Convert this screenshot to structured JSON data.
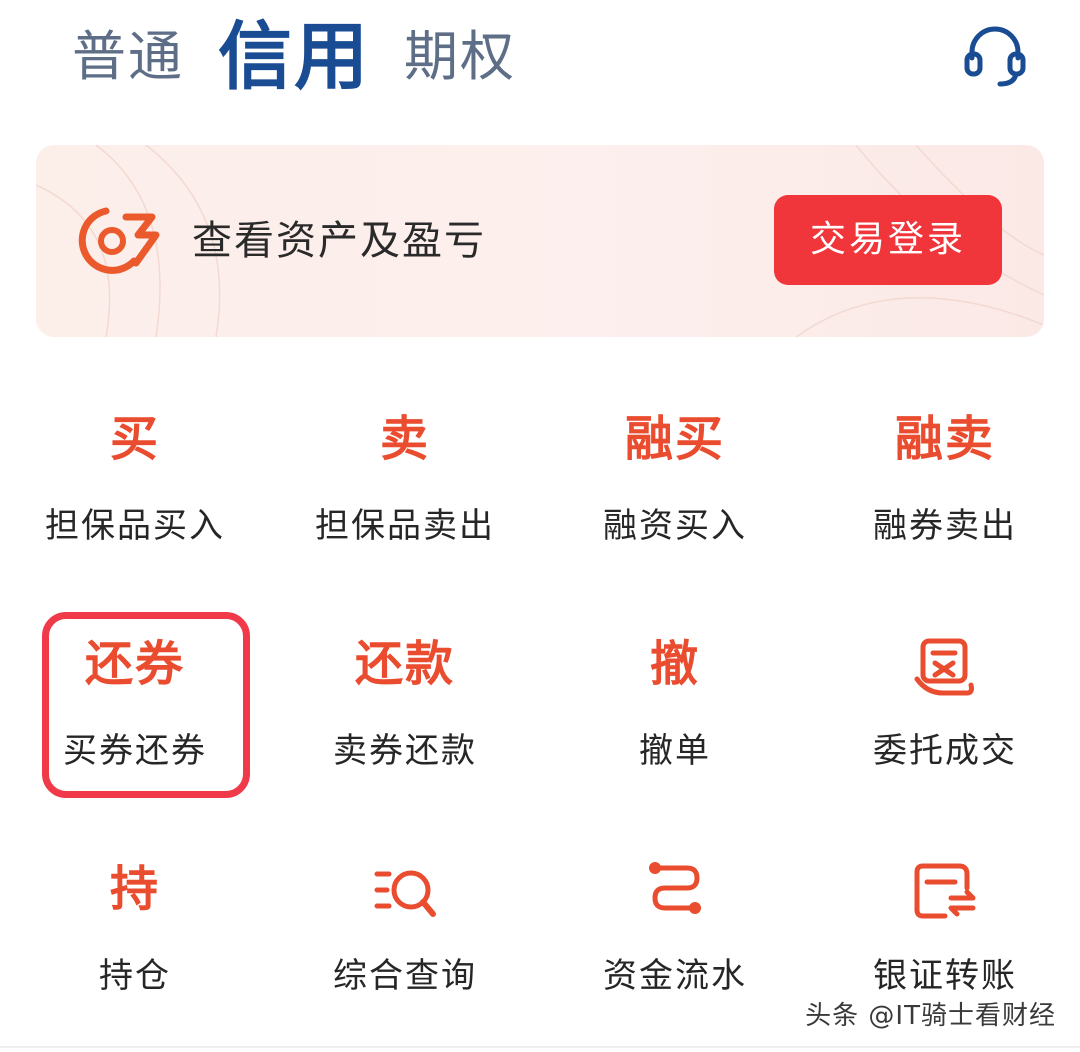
{
  "tabs": [
    {
      "label": "普通",
      "active": false
    },
    {
      "label": "信用",
      "active": true
    },
    {
      "label": "期权",
      "active": false
    }
  ],
  "header": {
    "service_icon": "headset-icon"
  },
  "banner": {
    "text": "查看资产及盈亏",
    "button_label": "交易登录",
    "logo_icon": "brand-logo-icon"
  },
  "grid": [
    {
      "glyph": "买",
      "label": "担保品买入"
    },
    {
      "glyph": "卖",
      "label": "担保品卖出"
    },
    {
      "glyph": "融买",
      "label": "融资买入"
    },
    {
      "glyph": "融卖",
      "label": "融券卖出"
    },
    {
      "glyph": "还券",
      "label": "买券还券",
      "highlighted": true
    },
    {
      "glyph": "还款",
      "label": "卖券还款"
    },
    {
      "glyph": "撤",
      "label": "撤单"
    },
    {
      "glyph": "",
      "icon": "entrust-deal-icon",
      "label": "委托成交"
    },
    {
      "glyph": "持",
      "label": "持仓"
    },
    {
      "glyph": "",
      "icon": "search-list-icon",
      "label": "综合查询"
    },
    {
      "glyph": "",
      "icon": "fund-flow-icon",
      "label": "资金流水"
    },
    {
      "glyph": "",
      "icon": "bank-transfer-icon",
      "label": "银证转账"
    }
  ],
  "watermark": "头条 @IT骑士看财经",
  "colors": {
    "accent": "#ea4c2f",
    "brand_blue": "#1a4c93",
    "button_red": "#f0353b",
    "highlight": "#f03a4a"
  }
}
